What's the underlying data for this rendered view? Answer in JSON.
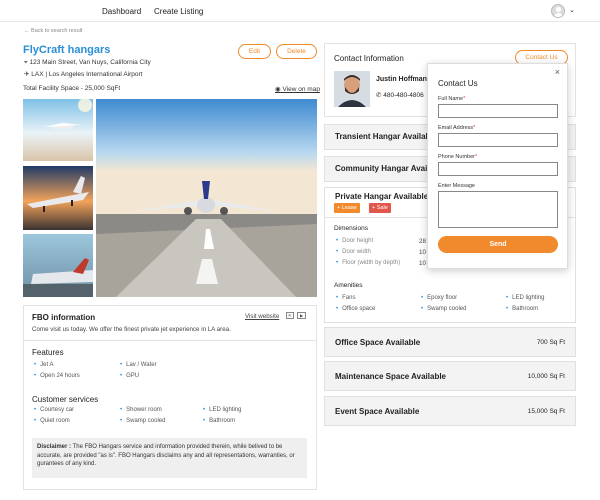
{
  "nav": {
    "dashboard": "Dashboard",
    "create_listing": "Create Listing"
  },
  "back_link": "Back to search result",
  "listing": {
    "title": "FlyCraft hangars",
    "address": "123 Main Street, Van Nuys, California City",
    "airport_code": "LAX",
    "airport_name": "Los Angeles International Airport",
    "total_space": "Total Facility Space - 25,000 SqFt",
    "view_map": "View on map",
    "edit": "Edit",
    "delete": "Delete"
  },
  "fbo": {
    "title": "FBO information",
    "visit": "Visit website",
    "desc": "Come visit us today. We offer the finest private jet experience in LA area.",
    "features_title": "Features",
    "features": [
      "Jet A",
      "Open 24 hours",
      "Lav / Water",
      "GPU"
    ],
    "services_title": "Customer services",
    "services": [
      "Courtesy car",
      "Quiet room",
      "Shower room",
      "Swamp cooled",
      "LED lighting",
      "Bathroom"
    ],
    "disclaimer_label": "Disclaimer :",
    "disclaimer_text": "The FBO Hangars service and information provided therein, while belived to be accurate, are provided \"as is\". FBO Hangars disclaims any and all representations, warranties, or gurantees of any kind."
  },
  "contact": {
    "title": "Contact Information",
    "button": "Contact Us",
    "name": "Justin Hoffman",
    "phone": "480-480-4806"
  },
  "sections": {
    "transient": "Transient Hangar Available",
    "community": "Community Hangar Available",
    "private": "Private Hangar Available",
    "lease": "+ Lease",
    "sale": "+ Sale",
    "dimensions_title": "Dimensions",
    "dimensions": [
      {
        "label": "Door height",
        "value": "28"
      },
      {
        "label": "Door width",
        "value": "10"
      },
      {
        "label": "Floor (width by depth)",
        "value": "10"
      }
    ],
    "amenities_title": "Amenities",
    "amenities": [
      "Fans",
      "Office space",
      "Epoxy floor",
      "Swamp cooled",
      "LED lighting",
      "Bathroom"
    ],
    "office": {
      "label": "Office Space Available",
      "value": "700 Sq Ft"
    },
    "maintenance": {
      "label": "Maintenance Space Available",
      "value": "10,000 Sq Ft"
    },
    "event": {
      "label": "Event Space Available",
      "value": "15,000 Sq Ft"
    }
  },
  "popup": {
    "title": "Contact Us",
    "close": "×",
    "full_name": "Full Name",
    "email": "Email Address",
    "phone": "Phone Number",
    "message": "Enter Message",
    "send": "Send",
    "required_mark": "*"
  },
  "colors": {
    "accent": "#f08a2c",
    "link": "#2a8fd6",
    "lease": "#f08a2c",
    "sale": "#e2574c"
  }
}
